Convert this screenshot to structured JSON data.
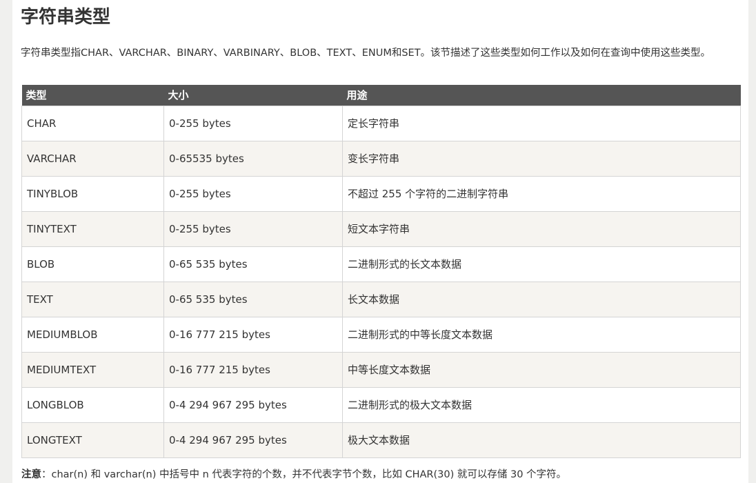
{
  "title": "字符串类型",
  "intro": "字符串类型指CHAR、VARCHAR、BINARY、VARBINARY、BLOB、TEXT、ENUM和SET。该节描述了这些类型如何工作以及如何在查询中使用这些类型。",
  "table": {
    "headers": [
      "类型",
      "大小",
      "用途"
    ],
    "rows": [
      {
        "type": "CHAR",
        "size": "0-255 bytes",
        "usage": "定长字符串"
      },
      {
        "type": "VARCHAR",
        "size": "0-65535 bytes",
        "usage": "变长字符串"
      },
      {
        "type": "TINYBLOB",
        "size": "0-255 bytes",
        "usage": "不超过 255 个字符的二进制字符串"
      },
      {
        "type": "TINYTEXT",
        "size": "0-255 bytes",
        "usage": "短文本字符串"
      },
      {
        "type": "BLOB",
        "size": "0-65 535 bytes",
        "usage": "二进制形式的长文本数据"
      },
      {
        "type": "TEXT",
        "size": "0-65 535 bytes",
        "usage": "长文本数据"
      },
      {
        "type": "MEDIUMBLOB",
        "size": "0-16 777 215 bytes",
        "usage": "二进制形式的中等长度文本数据"
      },
      {
        "type": "MEDIUMTEXT",
        "size": "0-16 777 215 bytes",
        "usage": "中等长度文本数据"
      },
      {
        "type": "LONGBLOB",
        "size": "0-4 294 967 295 bytes",
        "usage": "二进制形式的极大文本数据"
      },
      {
        "type": "LONGTEXT",
        "size": "0-4 294 967 295 bytes",
        "usage": "极大文本数据"
      }
    ]
  },
  "note": {
    "label": "注意",
    "text": "：char(n) 和 varchar(n) 中括号中 n 代表字符的个数，并不代表字节个数，比如 CHAR(30) 就可以存储 30 个字符。"
  }
}
